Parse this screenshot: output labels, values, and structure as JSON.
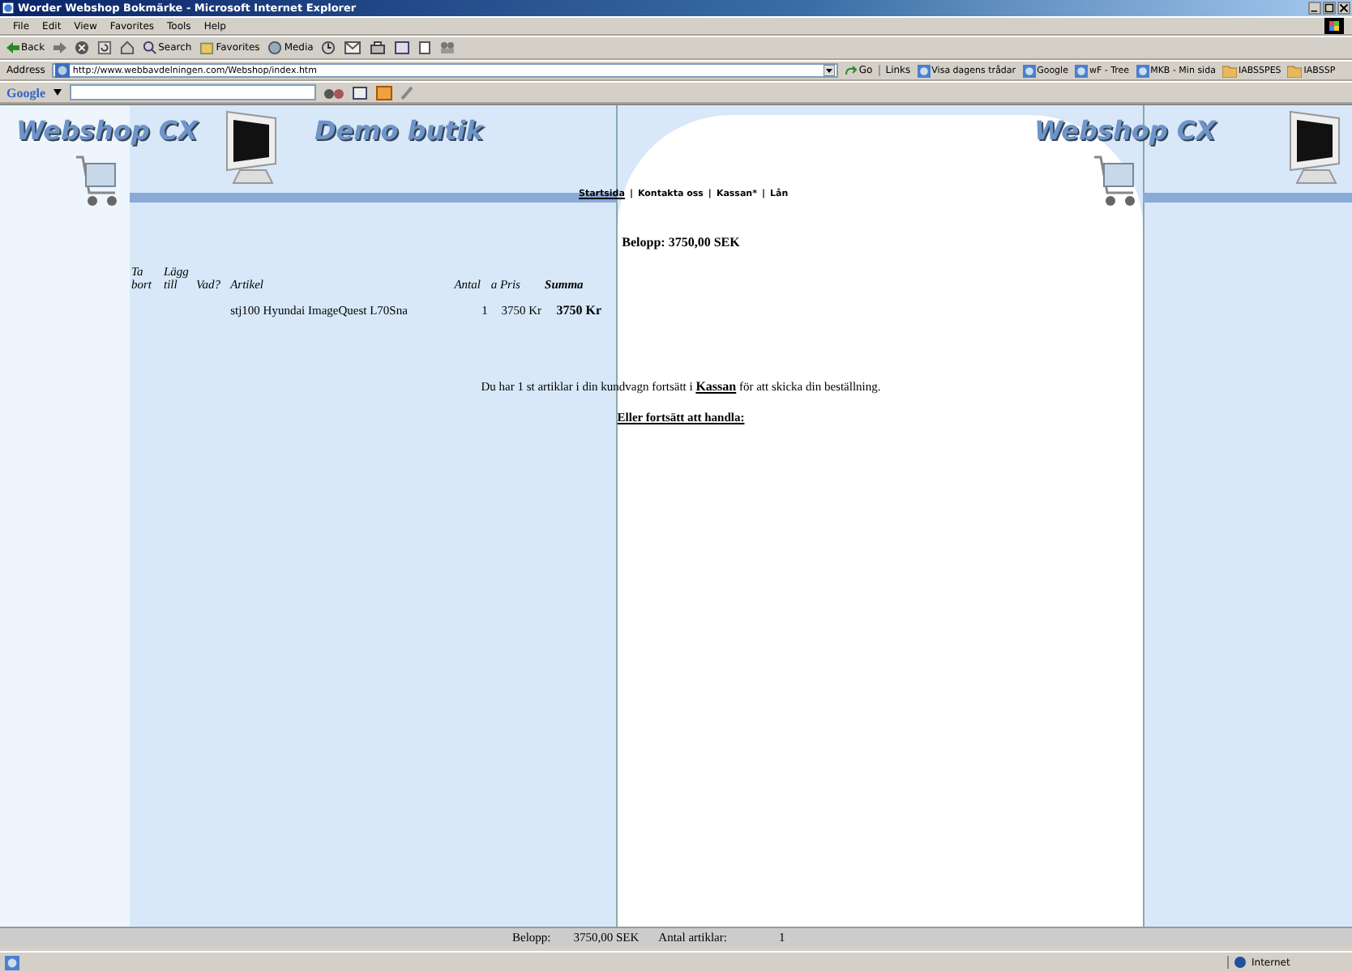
{
  "window": {
    "title": "Worder Webshop Bokmärke - Microsoft Internet Explorer"
  },
  "menu": [
    "File",
    "Edit",
    "View",
    "Favorites",
    "Tools",
    "Help"
  ],
  "toolbar": {
    "back": "Back",
    "search": "Search",
    "favorites": "Favorites",
    "media": "Media"
  },
  "address_bar": {
    "label": "Address",
    "value": "http://www.webbavdelningen.com/Webshop/index.htm",
    "go": "Go",
    "links_label": "Links",
    "links": [
      {
        "label": "Visa dagens trådar",
        "kind": "page"
      },
      {
        "label": "Google",
        "kind": "page"
      },
      {
        "label": "wF - Tree",
        "kind": "page"
      },
      {
        "label": "MKB - Min sida",
        "kind": "page"
      },
      {
        "label": "IABSSPES",
        "kind": "folder"
      },
      {
        "label": "IABSSP",
        "kind": "folder"
      }
    ]
  },
  "google_bar": {
    "logo": "Google"
  },
  "header": {
    "logo": "Webshop CX",
    "title": "Demo butik",
    "logo_right": "Webshop CX"
  },
  "nav_separator": "|",
  "nav": [
    {
      "label": "Startsida",
      "selected": true
    },
    {
      "label": "Kontakta oss",
      "selected": false
    },
    {
      "label": "Kassan*",
      "selected": false
    },
    {
      "label": "Lån",
      "selected": false
    }
  ],
  "total": "Belopp: 3750,00 SEK",
  "cart_table": {
    "columns": [
      "Ta bort",
      "Lägg till",
      "Vad?",
      "Artikel",
      "Antal",
      "a Pris",
      "Summa"
    ],
    "rows": [
      {
        "article": "stj100 Hyundai ImageQuest L70Sna",
        "quantity": "1",
        "price": "3750 Kr",
        "sum": "3750 Kr"
      }
    ]
  },
  "message": {
    "before": "Du har 1 st artiklar i din kundvagn fortsätt i",
    "link": "Kassan",
    "after": "för att skicka din beställning."
  },
  "continue_link": "Eller fortsätt att handla:",
  "footer_bar": {
    "amount_label": "Belopp:",
    "amount": "3750,00 SEK",
    "count_label": "Antal artiklar:",
    "count": "1"
  },
  "status_bar": {
    "zone": "Internet"
  }
}
